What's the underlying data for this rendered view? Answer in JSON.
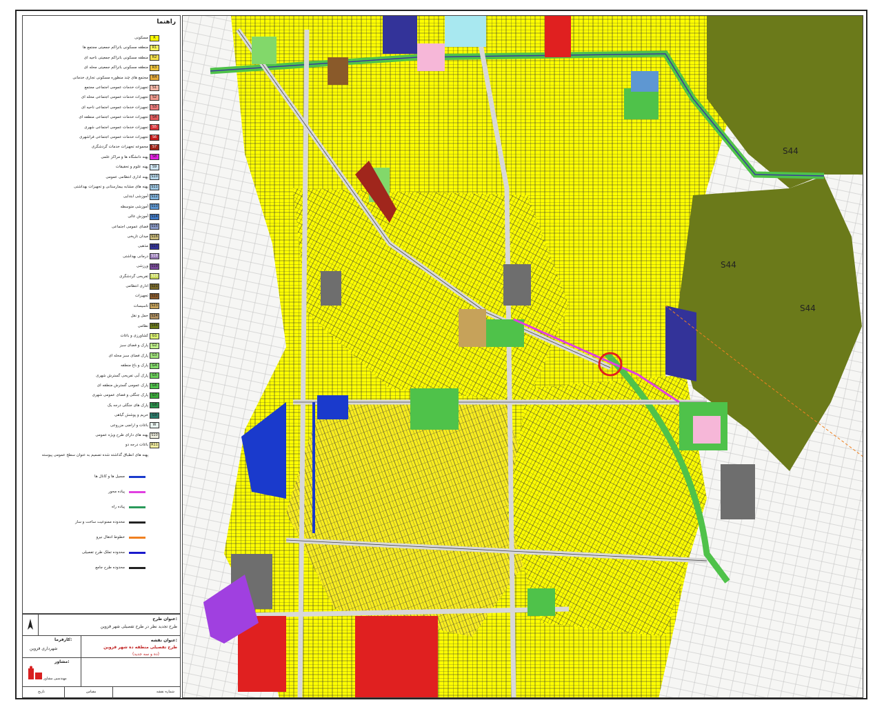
{
  "legend": {
    "title": "راهنما",
    "items": [
      {
        "code": "R",
        "color": "#ffff00",
        "label": "مسکونی"
      },
      {
        "code": "R1",
        "color": "#f7f45c",
        "label": "منطقه مسکونی باتراکم جمعیتی مجتمع ها"
      },
      {
        "code": "R2",
        "color": "#f4e04a",
        "label": "منطقه مسکونی باتراکم جمعیتی ناحیه ای"
      },
      {
        "code": "R3",
        "color": "#efc43c",
        "label": "منطقه مسکونی باتراکم جمعیتی محله ای"
      },
      {
        "code": "R4",
        "color": "#e4a93a",
        "label": "مجتمع های چند منظوره مسکونی تجاری خدماتی"
      },
      {
        "code": "S1",
        "color": "#f6b7a8",
        "label": "تجهیزات خدمات عمومی اجتماعی مجتمع"
      },
      {
        "code": "S2",
        "color": "#f09a8e",
        "label": "تجهیزات خدمات عمومی اجتماعی محله ای"
      },
      {
        "code": "S3",
        "color": "#e9797a",
        "label": "تجهیزات خدمات عمومی اجتماعی ناحیه ای"
      },
      {
        "code": "S4",
        "color": "#e05a5c",
        "label": "تجهیزات خدمات عمومی اجتماعی منطقه ای"
      },
      {
        "code": "S5",
        "color": "#d7343a",
        "label": "تجهیزات خدمات عمومی اجتماعی شهری"
      },
      {
        "code": "S6",
        "color": "#c41c1c",
        "label": "تجهیزات خدمات عمومی اجتماعی فراشهری"
      },
      {
        "code": "S7",
        "color": "#a0261c",
        "label": "مجموعه تجهیزات خدمات گردشگری"
      },
      {
        "code": "S8",
        "color": "#e020e0",
        "label": "پهنه دانشگاه ها و مراکز علمی"
      },
      {
        "code": "S9",
        "color": "#cfe6f2",
        "label": "پهنه علوم و تحقیقات"
      },
      {
        "code": "S10",
        "color": "#b6d7ea",
        "label": "پهنه اداری انتظامی عمومی"
      },
      {
        "code": "S11",
        "color": "#9ec7e2",
        "label": "پهنه های مشابه بیمارستانی و تجهیزات بهداشتی"
      },
      {
        "code": "S12",
        "color": "#7fb2dc",
        "label": "آموزشی ابتدایی"
      },
      {
        "code": "S13",
        "color": "#5e97d2",
        "label": "آموزشی متوسطه"
      },
      {
        "code": "S14",
        "color": "#3f79c6",
        "label": "آموزش عالی"
      },
      {
        "code": "S15",
        "color": "#8a9ac8",
        "label": "فضای عمومی اجتماعی"
      },
      {
        "code": "S16",
        "color": "#c8b878",
        "label": "میدان تاریخی"
      },
      {
        "code": "S17",
        "color": "#333399",
        "label": "مذهبی"
      },
      {
        "code": "S18",
        "color": "#9a7cb8",
        "label": "درمانی بهداشتی"
      },
      {
        "code": "S19",
        "color": "#7a4a9c",
        "label": "ورزشی"
      },
      {
        "code": "S20",
        "color": "#c8d85a",
        "label": "تفریحی گردشگری"
      },
      {
        "code": "S21",
        "color": "#7a6a2a",
        "label": "اداری انتظامی"
      },
      {
        "code": "S22",
        "color": "#8a5a2a",
        "label": "تجهیزات"
      },
      {
        "code": "S23",
        "color": "#c6a25a",
        "label": "تاسیسات"
      },
      {
        "code": "S24",
        "color": "#b09060",
        "label": "حمل و نقل"
      },
      {
        "code": "S44",
        "color": "#6b7a1a",
        "label": "نظامی"
      },
      {
        "code": "G1",
        "color": "#d8ef70",
        "label": "کشاورزی و باغات"
      },
      {
        "code": "G2",
        "color": "#bff08a",
        "label": "پارک و فضای سبز"
      },
      {
        "code": "G3",
        "color": "#9ee07a",
        "label": "پارک فضای سبز محله ای"
      },
      {
        "code": "G4",
        "color": "#82d86a",
        "label": "پارک و باغ منطقه"
      },
      {
        "code": "G5",
        "color": "#6bcf5a",
        "label": "پارک آبی تفریحی گسترش شهری"
      },
      {
        "code": "G6",
        "color": "#4fc24a",
        "label": "پارک عمومی گسترش منطقه ای"
      },
      {
        "code": "G7",
        "color": "#3aa83a",
        "label": "پارک جنگلی و فضای عمومی شهری"
      },
      {
        "code": "G8",
        "color": "#2a8f4a",
        "label": "پارک های جنگلی درجه یک"
      },
      {
        "code": "G9",
        "color": "#2a7a6a",
        "label": "حریم و پوشش گیاهی"
      },
      {
        "code": "W",
        "color": "#e8f4f0",
        "label": "باغات و اراضی مزروعی"
      },
      {
        "code": "S10",
        "color": "#f0f0e0",
        "label": "پهنه های دارای طرح ویژه عمومی"
      },
      {
        "code": "R11",
        "color": "#f6f0a0",
        "label": "باغات درجه دو"
      },
      {
        "code": "",
        "color": "",
        "label": "پهنه های انطباق گذاشته شده تصمیم به عنوان سطح عمومی پیوسته"
      }
    ],
    "lines": [
      {
        "label": "مسیل ها و کانال ها",
        "color": "#1a3acc"
      },
      {
        "label": "پیاده محور",
        "color": "#e040e0"
      },
      {
        "label": "پیاده راه",
        "color": "#2a9a5a"
      },
      {
        "label": "محدوده ممنوعیت ساخت و ساز",
        "color": "#222222"
      },
      {
        "label": "خطوط انتقال نیرو",
        "color": "#f08020"
      },
      {
        "label": "محدوده تملک طرح تفصیلی",
        "color": "#1a1acc"
      },
      {
        "label": "محدوده طرح جامع",
        "color": "#222222"
      }
    ]
  },
  "titleblock": {
    "project_label": "عنوان طرح:",
    "project_value": "طرح تجدید نظر در طرح تفصیلی شهر قزوین",
    "employer_label": "کارفرما:",
    "employer_value": "شهرداری قزوین",
    "map_label": "عنوان نقشه:",
    "map_value_1": "طرح تفصیلی منطقه ده شهر قزوین",
    "map_value_2": "(ده و سه جدید)",
    "consultant_label": "مشاور:",
    "consultant_value": "مهندسین مشاور",
    "footer_1": "شماره نقشه",
    "footer_2": "مقیاس",
    "footer_3": "تاریخ"
  },
  "map": {
    "zones": [
      "S44",
      "S44",
      "S44"
    ]
  },
  "colors": {
    "residential": "#ffff00",
    "military": "#6b7a1a",
    "green": "#4fc24a",
    "red": "#e02020",
    "blue": "#1a3acc",
    "gray": "#6e6e6e"
  }
}
